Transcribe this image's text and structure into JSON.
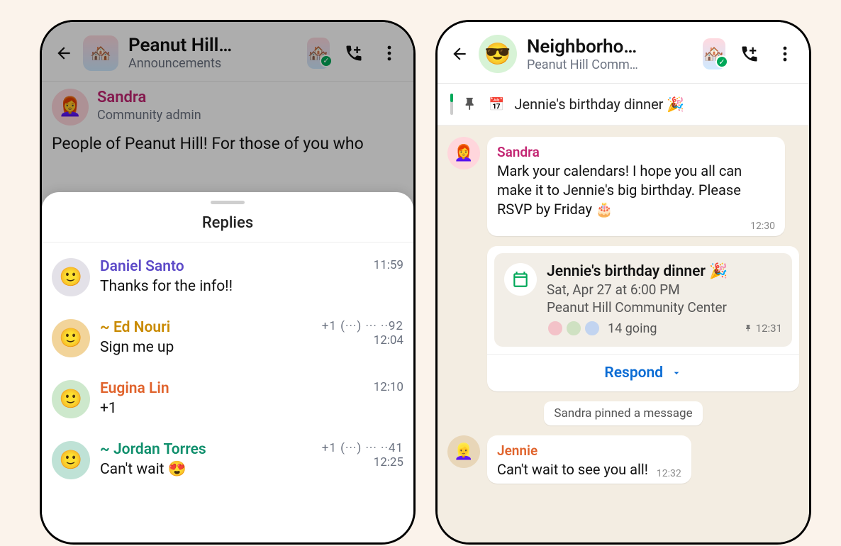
{
  "left": {
    "header": {
      "title": "Peanut Hill…",
      "subtitle": "Announcements"
    },
    "original": {
      "name": "Sandra",
      "role": "Community admin",
      "text": "People of Peanut Hill! For those of you who"
    },
    "sheet_title": "Replies",
    "replies": [
      {
        "name": "Daniel Santo",
        "color": "#5d4ac8",
        "text": "Thanks for the info!!",
        "phone_fragment": "",
        "time": "11:59",
        "avatar_bg": "#e3e1e8"
      },
      {
        "name": "~ Ed Nouri",
        "color": "#c98a00",
        "text": "Sign me up",
        "phone_fragment": "+1 (···) ··· ··92",
        "time": "12:04",
        "avatar_bg": "#f2d49a"
      },
      {
        "name": "Eugina Lin",
        "color": "#e0632c",
        "text": "+1",
        "phone_fragment": "",
        "time": "12:10",
        "avatar_bg": "#cde8cc"
      },
      {
        "name": "~ Jordan Torres",
        "color": "#0f8f6c",
        "text": "Can't wait 😍",
        "phone_fragment": "+1 (···) ··· ··41",
        "time": "12:25",
        "avatar_bg": "#bfe2d6"
      }
    ]
  },
  "right": {
    "header": {
      "title": "Neighborho…",
      "subtitle": "Peanut Hill Comm…"
    },
    "pinned": {
      "icon": "📅",
      "text": "Jennie's birthday dinner 🎉"
    },
    "sandra_msg": {
      "sender": "Sandra",
      "sender_color": "#c32673",
      "text": "Mark your calendars! I hope you all can make it to Jennie's big birthday. Please RSVP by Friday 🎂",
      "time": "12:30"
    },
    "event": {
      "title": "Jennie's birthday dinner 🎉",
      "datetime": "Sat, Apr 27 at 6:00 PM",
      "location": "Peanut Hill Community Center",
      "going_text": "14 going",
      "time": "12:31",
      "respond_label": "Respond"
    },
    "system_text": "Sandra pinned a message",
    "jennie_msg": {
      "sender": "Jennie",
      "sender_color": "#e0632c",
      "text": "Can't wait to see you all!",
      "time": "12:32"
    }
  }
}
